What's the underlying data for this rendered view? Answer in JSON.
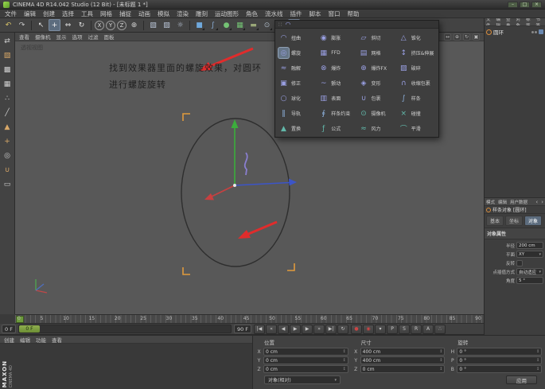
{
  "window": {
    "title": "CINEMA 4D R14.042 Studio (12 Bit) - [未标题 1 *]",
    "controls": [
      {
        "name": "minimize-button",
        "glyph": "–"
      },
      {
        "name": "maximize-button",
        "glyph": "□"
      },
      {
        "name": "close-button",
        "glyph": "×"
      }
    ]
  },
  "branding": {
    "line1": "MAXON",
    "line2": "CINEMA 4D"
  },
  "menubar": {
    "items": [
      "文件",
      "编辑",
      "创建",
      "选择",
      "工具",
      "网格",
      "捕捉",
      "动画",
      "模拟",
      "渲染",
      "雕刻",
      "运动图形",
      "角色",
      "流水线",
      "插件",
      "脚本",
      "窗口",
      "帮助"
    ]
  },
  "toolbar": {
    "items": [
      {
        "name": "undo-button",
        "glyph": "↶",
        "color": "#d9c469"
      },
      {
        "name": "redo-button",
        "glyph": "↷",
        "color": "#c9c9c9"
      },
      {
        "name": "toolbar-separator",
        "kind": "sep",
        "interactable": false
      },
      {
        "name": "live-selection-tool",
        "glyph": "↖",
        "color": "#e2e2e2"
      },
      {
        "name": "move-tool",
        "glyph": "+",
        "color": "#f0f0f0",
        "active": true
      },
      {
        "name": "scale-tool",
        "glyph": "⇔",
        "color": "#e2e2e2"
      },
      {
        "name": "rotate-tool",
        "glyph": "↻",
        "color": "#e2e2e2"
      },
      {
        "name": "toolbar-separator",
        "kind": "sep",
        "interactable": false
      },
      {
        "name": "lock-x-axis",
        "glyph": "X",
        "kind": "axis"
      },
      {
        "name": "lock-y-axis",
        "glyph": "Y",
        "kind": "axis"
      },
      {
        "name": "lock-z-axis",
        "glyph": "Z",
        "kind": "axis"
      },
      {
        "name": "coordinate-system-toggle",
        "glyph": "⊕",
        "color": "#cfcfcf"
      },
      {
        "name": "toolbar-separator",
        "kind": "sep",
        "interactable": false
      },
      {
        "name": "render-view-button",
        "glyph": "▧",
        "color": "#b9c4d6"
      },
      {
        "name": "render-picture-viewer-button",
        "glyph": "▨",
        "color": "#b9c4d6"
      },
      {
        "name": "render-settings-button",
        "glyph": "☼",
        "color": "#b9c4d6"
      },
      {
        "name": "toolbar-separator",
        "kind": "sep",
        "interactable": false
      },
      {
        "name": "add-cube-menu",
        "glyph": "■",
        "color": "#6fa8dc",
        "kind": "drop"
      },
      {
        "name": "add-spline-menu",
        "glyph": "∫",
        "color": "#8fb4e0",
        "kind": "drop"
      },
      {
        "name": "add-subdivision-menu",
        "glyph": "●",
        "color": "#74c274",
        "kind": "drop"
      },
      {
        "name": "add-array-menu",
        "glyph": "▦",
        "color": "#74c274",
        "kind": "drop"
      },
      {
        "name": "add-floor-menu",
        "glyph": "▬",
        "color": "#9aa878",
        "kind": "drop"
      },
      {
        "name": "add-camera-menu",
        "glyph": "⊙",
        "color": "#a8b4c0",
        "kind": "drop"
      },
      {
        "name": "add-light-menu",
        "glyph": "☀",
        "color": "#e0c468",
        "kind": "drop"
      },
      {
        "name": "add-deformer-menu",
        "glyph": "◠",
        "color": "#9aa0e4",
        "kind": "drop",
        "active": true
      }
    ]
  },
  "left_toolbar": {
    "items": [
      {
        "name": "make-editable-button",
        "glyph": "⇄",
        "color": "#cfcfcf"
      },
      {
        "name": "model-mode-button",
        "glyph": "▧",
        "color": "#d8a868"
      },
      {
        "name": "texture-mode-button",
        "glyph": "▩",
        "color": "#cfcfcf"
      },
      {
        "name": "workplane-mode-button",
        "glyph": "▦",
        "color": "#cfcfcf"
      },
      {
        "name": "points-mode-button",
        "glyph": "∴",
        "color": "#cfcfcf"
      },
      {
        "name": "edges-mode-button",
        "glyph": "╱",
        "color": "#cfcfcf"
      },
      {
        "name": "polygons-mode-button",
        "glyph": "▲",
        "color": "#d8a868"
      },
      {
        "name": "enable-axis-button",
        "glyph": "+",
        "color": "#d8a868"
      },
      {
        "name": "viewport-solo-button",
        "glyph": "◎",
        "color": "#cfcfcf"
      },
      {
        "name": "enable-snap-button",
        "glyph": "∪",
        "color": "#d8a868"
      },
      {
        "name": "workplane-lock-button",
        "glyph": "▭",
        "color": "#cfcfcf"
      }
    ]
  },
  "viewport": {
    "menu": [
      "查看",
      "摄像机",
      "显示",
      "选项",
      "过滤",
      "面板"
    ],
    "nav_icons": [
      {
        "name": "pan-view-icon",
        "glyph": "↔"
      },
      {
        "name": "zoom-view-icon",
        "glyph": "⊕"
      },
      {
        "name": "rotate-view-icon",
        "glyph": "↻"
      },
      {
        "name": "toggle-view-icon",
        "glyph": "▣"
      }
    ],
    "label": "透视视图",
    "annotation": {
      "line1": "找到效果器里面的螺旋效果，对圆环",
      "line2": "进行螺旋旋转"
    }
  },
  "deformer_menu": {
    "items": [
      {
        "name": "deformer-bend",
        "label": "扭曲",
        "glyph": "◠",
        "color": "#9aa0e4"
      },
      {
        "name": "deformer-bulge",
        "label": "膨胀",
        "glyph": "◉",
        "color": "#9aa0e4"
      },
      {
        "name": "deformer-shear",
        "label": "斜切",
        "glyph": "▱",
        "color": "#9aa0e4"
      },
      {
        "name": "deformer-taper",
        "label": "锥化",
        "glyph": "△",
        "color": "#9aa0e4"
      },
      {
        "name": "deformer-twist",
        "label": "螺旋",
        "glyph": "◎",
        "color": "#9aa0e4",
        "active": true
      },
      {
        "name": "deformer-ffd",
        "label": "FFD",
        "glyph": "▦",
        "color": "#9aa0e4"
      },
      {
        "name": "deformer-mesh",
        "label": "网格",
        "glyph": "▤",
        "color": "#9aa0e4"
      },
      {
        "name": "deformer-squash-stretch",
        "label": "挤压&伸展",
        "glyph": "↕",
        "color": "#9aa0e4"
      },
      {
        "name": "deformer-melt",
        "label": "融解",
        "glyph": "≈",
        "color": "#9aa0e4"
      },
      {
        "name": "deformer-explosion",
        "label": "爆炸",
        "glyph": "⊗",
        "color": "#9aa0e4"
      },
      {
        "name": "deformer-explosion-fx",
        "label": "爆炸FX",
        "glyph": "⊕",
        "color": "#9aa0e4"
      },
      {
        "name": "deformer-shatter",
        "label": "破碎",
        "glyph": "▨",
        "color": "#9aa0e4"
      },
      {
        "name": "deformer-correction",
        "label": "修正",
        "glyph": "▣",
        "color": "#9aa0e4"
      },
      {
        "name": "deformer-jiggle",
        "label": "颤动",
        "glyph": "~",
        "color": "#9aa0e4"
      },
      {
        "name": "deformer-morph",
        "label": "变形",
        "glyph": "◈",
        "color": "#9aa0e4"
      },
      {
        "name": "deformer-shrink-wrap",
        "label": "收缩包裹",
        "glyph": "∩",
        "color": "#9aa0e4"
      },
      {
        "name": "deformer-spherify",
        "label": "球化",
        "glyph": "○",
        "color": "#9aa0e4"
      },
      {
        "name": "deformer-surface",
        "label": "表面",
        "glyph": "▥",
        "color": "#9aa0e4"
      },
      {
        "name": "deformer-wrap",
        "label": "包裹",
        "glyph": "∪",
        "color": "#9aa0e4"
      },
      {
        "name": "deformer-spline",
        "label": "样条",
        "glyph": "∫",
        "color": "#8fb4e0"
      },
      {
        "name": "deformer-spline-rail",
        "label": "导轨",
        "glyph": "‖",
        "color": "#8fb4e0"
      },
      {
        "name": "deformer-spline-wrap",
        "label": "样条约束",
        "glyph": "∮",
        "color": "#8fb4e0"
      },
      {
        "name": "deformer-camera",
        "label": "摄像机",
        "glyph": "⊙",
        "color": "#62b8aa"
      },
      {
        "name": "deformer-collision",
        "label": "碰撞",
        "glyph": "×",
        "color": "#62b8aa"
      },
      {
        "name": "deformer-displacer",
        "label": "置换",
        "glyph": "▲",
        "color": "#62b8aa"
      },
      {
        "name": "deformer-formula",
        "label": "公式",
        "glyph": "ƒ",
        "color": "#62b8aa"
      },
      {
        "name": "deformer-wind",
        "label": "风力",
        "glyph": "≈",
        "color": "#62b8aa"
      },
      {
        "name": "deformer-smoothing",
        "label": "平滑",
        "glyph": "⌒",
        "color": "#62b8aa"
      }
    ]
  },
  "object_manager": {
    "tabs": [
      "文件",
      "编辑",
      "查看",
      "对象",
      "标签",
      "书签"
    ],
    "objects": [
      {
        "name": "圆环"
      }
    ]
  },
  "attributes": {
    "menu": [
      "模式",
      "编辑",
      "用户数据"
    ],
    "title": "样条对象 [圆环]",
    "tabs": [
      {
        "label": "基本"
      },
      {
        "label": "坐标"
      },
      {
        "label": "对象",
        "active": true
      }
    ],
    "section": "对象属性",
    "rows": [
      {
        "label": "半径",
        "value": "200 cm"
      },
      {
        "label": "平面",
        "value": "XY",
        "kind": "dropdown"
      },
      {
        "label": "反转",
        "value": "",
        "kind": "checkbox"
      },
      {
        "label": "点插值方式",
        "value": "自动适应",
        "kind": "dropdown"
      },
      {
        "label": "角度",
        "value": "5 °"
      }
    ]
  },
  "timeline": {
    "ticks": [
      "0",
      "5",
      "10",
      "15",
      "20",
      "25",
      "30",
      "35",
      "40",
      "45",
      "50",
      "55",
      "60",
      "65",
      "70",
      "75",
      "80",
      "85",
      "90"
    ]
  },
  "transport": {
    "start": "0 F",
    "slider_label": "0 F",
    "end": "90 F",
    "playback": [
      {
        "name": "goto-start-button",
        "glyph": "|◀"
      },
      {
        "name": "prev-key-button",
        "glyph": "«"
      },
      {
        "name": "prev-frame-button",
        "glyph": "◀"
      },
      {
        "name": "play-button",
        "glyph": "▶"
      },
      {
        "name": "next-frame-button",
        "glyph": "▶"
      },
      {
        "name": "next-key-button",
        "glyph": "»"
      },
      {
        "name": "goto-end-button",
        "glyph": "▶|"
      },
      {
        "name": "loop-button",
        "glyph": "↻"
      }
    ],
    "record": [
      {
        "name": "record-keyframe-button",
        "glyph": "●",
        "color": "#cc4545"
      },
      {
        "name": "autokey-button",
        "glyph": "◉",
        "color": "#cc4545"
      },
      {
        "name": "keyframe-selection-dropdown",
        "glyph": "▾"
      },
      {
        "name": "record-position-toggle",
        "glyph": "P"
      },
      {
        "name": "record-scale-toggle",
        "glyph": "S"
      },
      {
        "name": "record-rotation-toggle",
        "glyph": "R"
      },
      {
        "name": "record-parameter-toggle",
        "glyph": "A"
      },
      {
        "name": "record-pla-toggle",
        "glyph": "∴"
      }
    ]
  },
  "materials": {
    "tabs": [
      "创建",
      "编辑",
      "功能",
      "查看"
    ]
  },
  "coordinates": {
    "groups": [
      {
        "title": "位置",
        "rows": [
          [
            "X",
            "0 cm"
          ],
          [
            "Y",
            "0 cm"
          ],
          [
            "Z",
            "0 cm"
          ]
        ]
      },
      {
        "title": "尺寸",
        "rows": [
          [
            "X",
            "400 cm"
          ],
          [
            "Y",
            "400 cm"
          ],
          [
            "Z",
            "0 cm"
          ]
        ]
      },
      {
        "title": "旋转",
        "rows": [
          [
            "H",
            "0 °"
          ],
          [
            "P",
            "0 °"
          ],
          [
            "B",
            "0 °"
          ]
        ]
      }
    ],
    "mode_dropdown": "对象(相对)",
    "apply_button": "应用"
  }
}
